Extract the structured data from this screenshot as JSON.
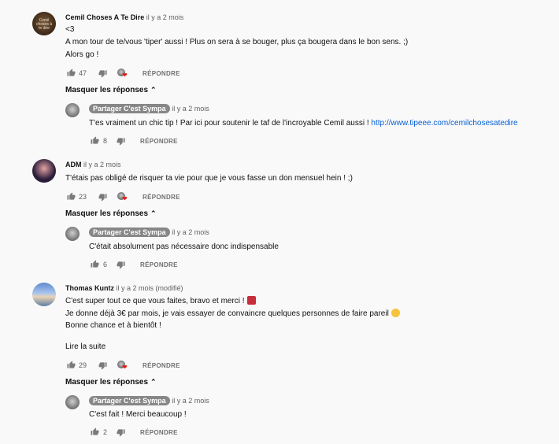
{
  "comments": [
    {
      "author": "Cemil Choses A Te Dire",
      "avatar_text": "Cemil choses à te dire",
      "time": "il y a 2 mois",
      "lines": [
        "<3",
        "A mon tour de te/vous 'tiper' aussi ! Plus on sera à se bouger, plus ça bougera dans le bon sens. ;)",
        "Alors go !"
      ],
      "likes": "47",
      "reply_label": "RÉPONDRE",
      "toggle_label": "Masquer les réponses",
      "reply": {
        "author": "Partager C'est Sympa",
        "time": "il y a 2 mois",
        "text": "T'es vraiment un chic tip ! Par ici pour soutenir le taf de l'incroyable Cemil aussi ! ",
        "link": "http://www.tipeee.com/cemilchosesatedire",
        "likes": "8",
        "reply_label": "RÉPONDRE"
      }
    },
    {
      "author": "ADM",
      "time": "il y a 2 mois",
      "lines": [
        "T'étais pas obligé de risquer ta vie pour que je vous fasse un don mensuel hein ! ;)"
      ],
      "likes": "23",
      "reply_label": "RÉPONDRE",
      "toggle_label": "Masquer les réponses",
      "reply": {
        "author": "Partager C'est Sympa",
        "time": "il y a 2 mois",
        "text": "C'était absolument pas nécessaire donc indispensable",
        "likes": "6",
        "reply_label": "RÉPONDRE"
      }
    },
    {
      "author": "Thomas Kuntz",
      "time": "il y a 2 mois (modifié)",
      "lines": [
        "C'est super tout ce que vous faites, bravo et merci !",
        "Je donne déjà 3€ par mois, je vais essayer de convaincre quelques personnes de faire pareil",
        "Bonne chance et à bientôt !"
      ],
      "read_more": "Lire la suite",
      "likes": "29",
      "reply_label": "RÉPONDRE",
      "toggle_label": "Masquer les réponses",
      "reply": {
        "author": "Partager C'est Sympa",
        "time": "il y a 2 mois",
        "text": "C'est fait ! Merci beaucoup !",
        "likes": "2",
        "reply_label": "RÉPONDRE"
      }
    }
  ],
  "icons": {
    "like": "thumb-up-icon",
    "dislike": "thumb-down-icon",
    "creator_heart": "creator-heart-icon",
    "chevron": "chevron-up-icon"
  },
  "colors": {
    "link": "#065fd4",
    "badge": "#878787",
    "heart": "#e62117",
    "background": "#f9f9f9"
  }
}
